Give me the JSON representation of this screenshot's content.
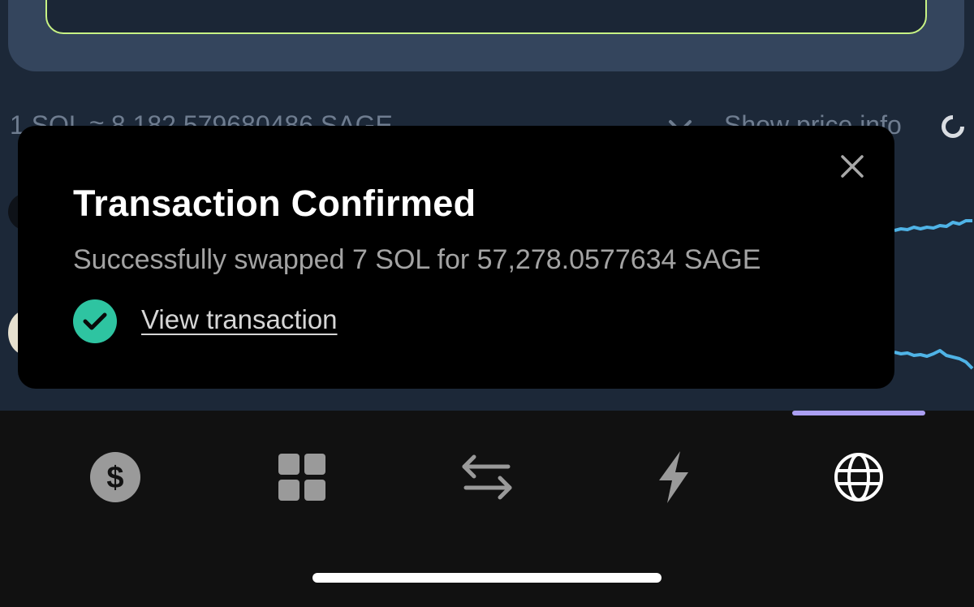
{
  "background": {
    "rate_text": "1 SOL ≈ 8.182.579680486 SAGE",
    "rate_arrow": "→",
    "price_info_label": "Show price info"
  },
  "toast": {
    "title": "Transaction Confirmed",
    "message": "Successfully swapped 7 SOL for 57,278.0577634 SAGE",
    "link_label": "View transaction",
    "close_icon": "close-icon",
    "status_icon": "check-circle-icon",
    "status_color": "#2ec4a1"
  },
  "bottom_nav": {
    "items": [
      {
        "icon": "dollar-icon",
        "active": false
      },
      {
        "icon": "grid-icon",
        "active": false
      },
      {
        "icon": "swap-arrows-icon",
        "active": false
      },
      {
        "icon": "lightning-icon",
        "active": false
      },
      {
        "icon": "globe-icon",
        "active": true
      }
    ],
    "active_color": "#ab9ff2"
  },
  "colors": {
    "accent_input_border": "#c7f284",
    "sparkline": "#4fb3e6",
    "background": "#1c2838"
  }
}
